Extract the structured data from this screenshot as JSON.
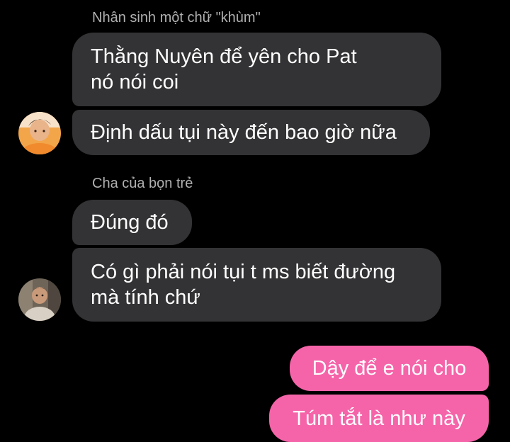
{
  "conversation": {
    "groups": [
      {
        "sender": "Nhân sinh một chữ \"khùm\"",
        "messages": [
          "Thằng Nuyên để yên cho Pat nó nói coi",
          "Định dấu tụi này đến bao giờ nữa"
        ]
      },
      {
        "sender": "Cha của bọn trẻ",
        "messages": [
          "Đúng đó",
          "Có gì phải nói tụi t ms biết đường mà tính chứ"
        ]
      }
    ],
    "outgoing": [
      "Dậy để e nói cho",
      "Túm tắt là như này"
    ]
  },
  "colors": {
    "background": "#000000",
    "incoming_bubble": "#333335",
    "outgoing_bubble": "#f564a9",
    "sender_text": "#b0b0b0"
  },
  "icons": {
    "avatar_1": "user-photo-icon",
    "avatar_2": "user-photo-icon"
  }
}
